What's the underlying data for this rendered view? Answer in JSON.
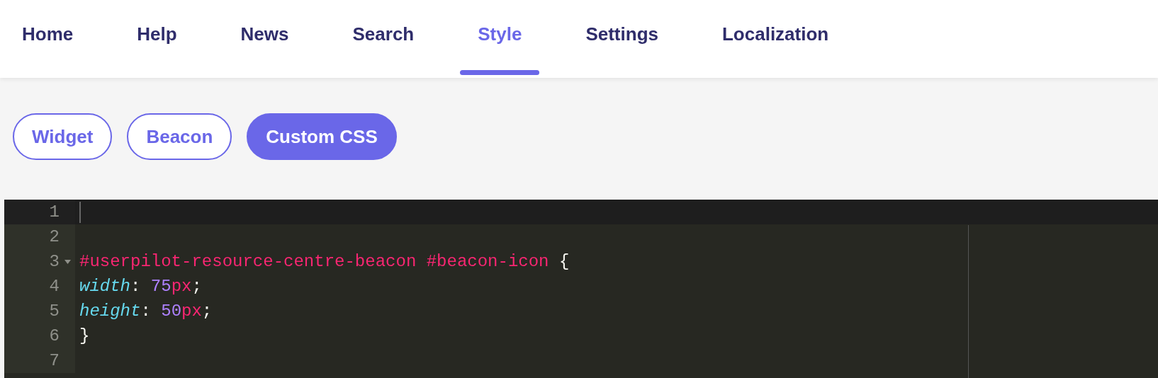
{
  "tabs": [
    {
      "label": "Home",
      "selected": false
    },
    {
      "label": "Help",
      "selected": false
    },
    {
      "label": "News",
      "selected": false
    },
    {
      "label": "Search",
      "selected": false
    },
    {
      "label": "Style",
      "selected": true
    },
    {
      "label": "Settings",
      "selected": false
    },
    {
      "label": "Localization",
      "selected": false
    }
  ],
  "subtabs": [
    {
      "label": "Widget",
      "selected": false
    },
    {
      "label": "Beacon",
      "selected": false
    },
    {
      "label": "Custom CSS",
      "selected": true
    }
  ],
  "editor": {
    "lines": [
      {
        "number": "1",
        "active": true
      },
      {
        "number": "2",
        "active": false
      },
      {
        "number": "3",
        "active": false,
        "foldable": true,
        "tokens": [
          {
            "kind": "selector",
            "text": "#userpilot-resource-centre-beacon #beacon-icon"
          },
          {
            "kind": "punct",
            "text": " {"
          }
        ]
      },
      {
        "number": "4",
        "active": false,
        "tokens": [
          {
            "kind": "property",
            "text": "width"
          },
          {
            "kind": "punct",
            "text": ": "
          },
          {
            "kind": "number",
            "text": "75"
          },
          {
            "kind": "unit",
            "text": "px"
          },
          {
            "kind": "punct",
            "text": ";"
          }
        ]
      },
      {
        "number": "5",
        "active": false,
        "tokens": [
          {
            "kind": "property",
            "text": "height"
          },
          {
            "kind": "punct",
            "text": ": "
          },
          {
            "kind": "number",
            "text": "50"
          },
          {
            "kind": "unit",
            "text": "px"
          },
          {
            "kind": "punct",
            "text": ";"
          }
        ]
      },
      {
        "number": "6",
        "active": false,
        "tokens": [
          {
            "kind": "punct",
            "text": "}"
          }
        ]
      },
      {
        "number": "7",
        "active": false
      }
    ]
  }
}
